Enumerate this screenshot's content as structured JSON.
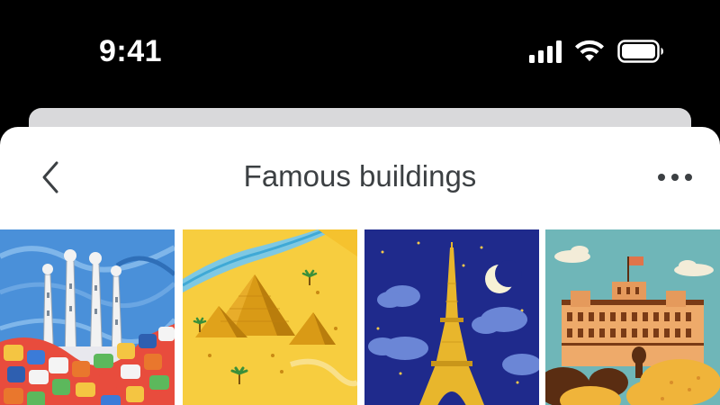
{
  "status_bar": {
    "time": "9:41",
    "icons": [
      "cellular-signal-icon",
      "wifi-icon",
      "battery-icon"
    ]
  },
  "header": {
    "title": "Famous buildings",
    "back_icon": "chevron-left-icon",
    "more_icon": "more-horizontal-icon"
  },
  "gallery": {
    "items": [
      {
        "subject": "sagrada-familia-illustration"
      },
      {
        "subject": "pyramids-illustration"
      },
      {
        "subject": "eiffel-tower-illustration"
      },
      {
        "subject": "palace-illustration"
      }
    ]
  },
  "colors": {
    "background": "#000000",
    "sheet": "#ffffff",
    "back_sheet": "#d9d9db",
    "title_text": "#3c4043"
  }
}
